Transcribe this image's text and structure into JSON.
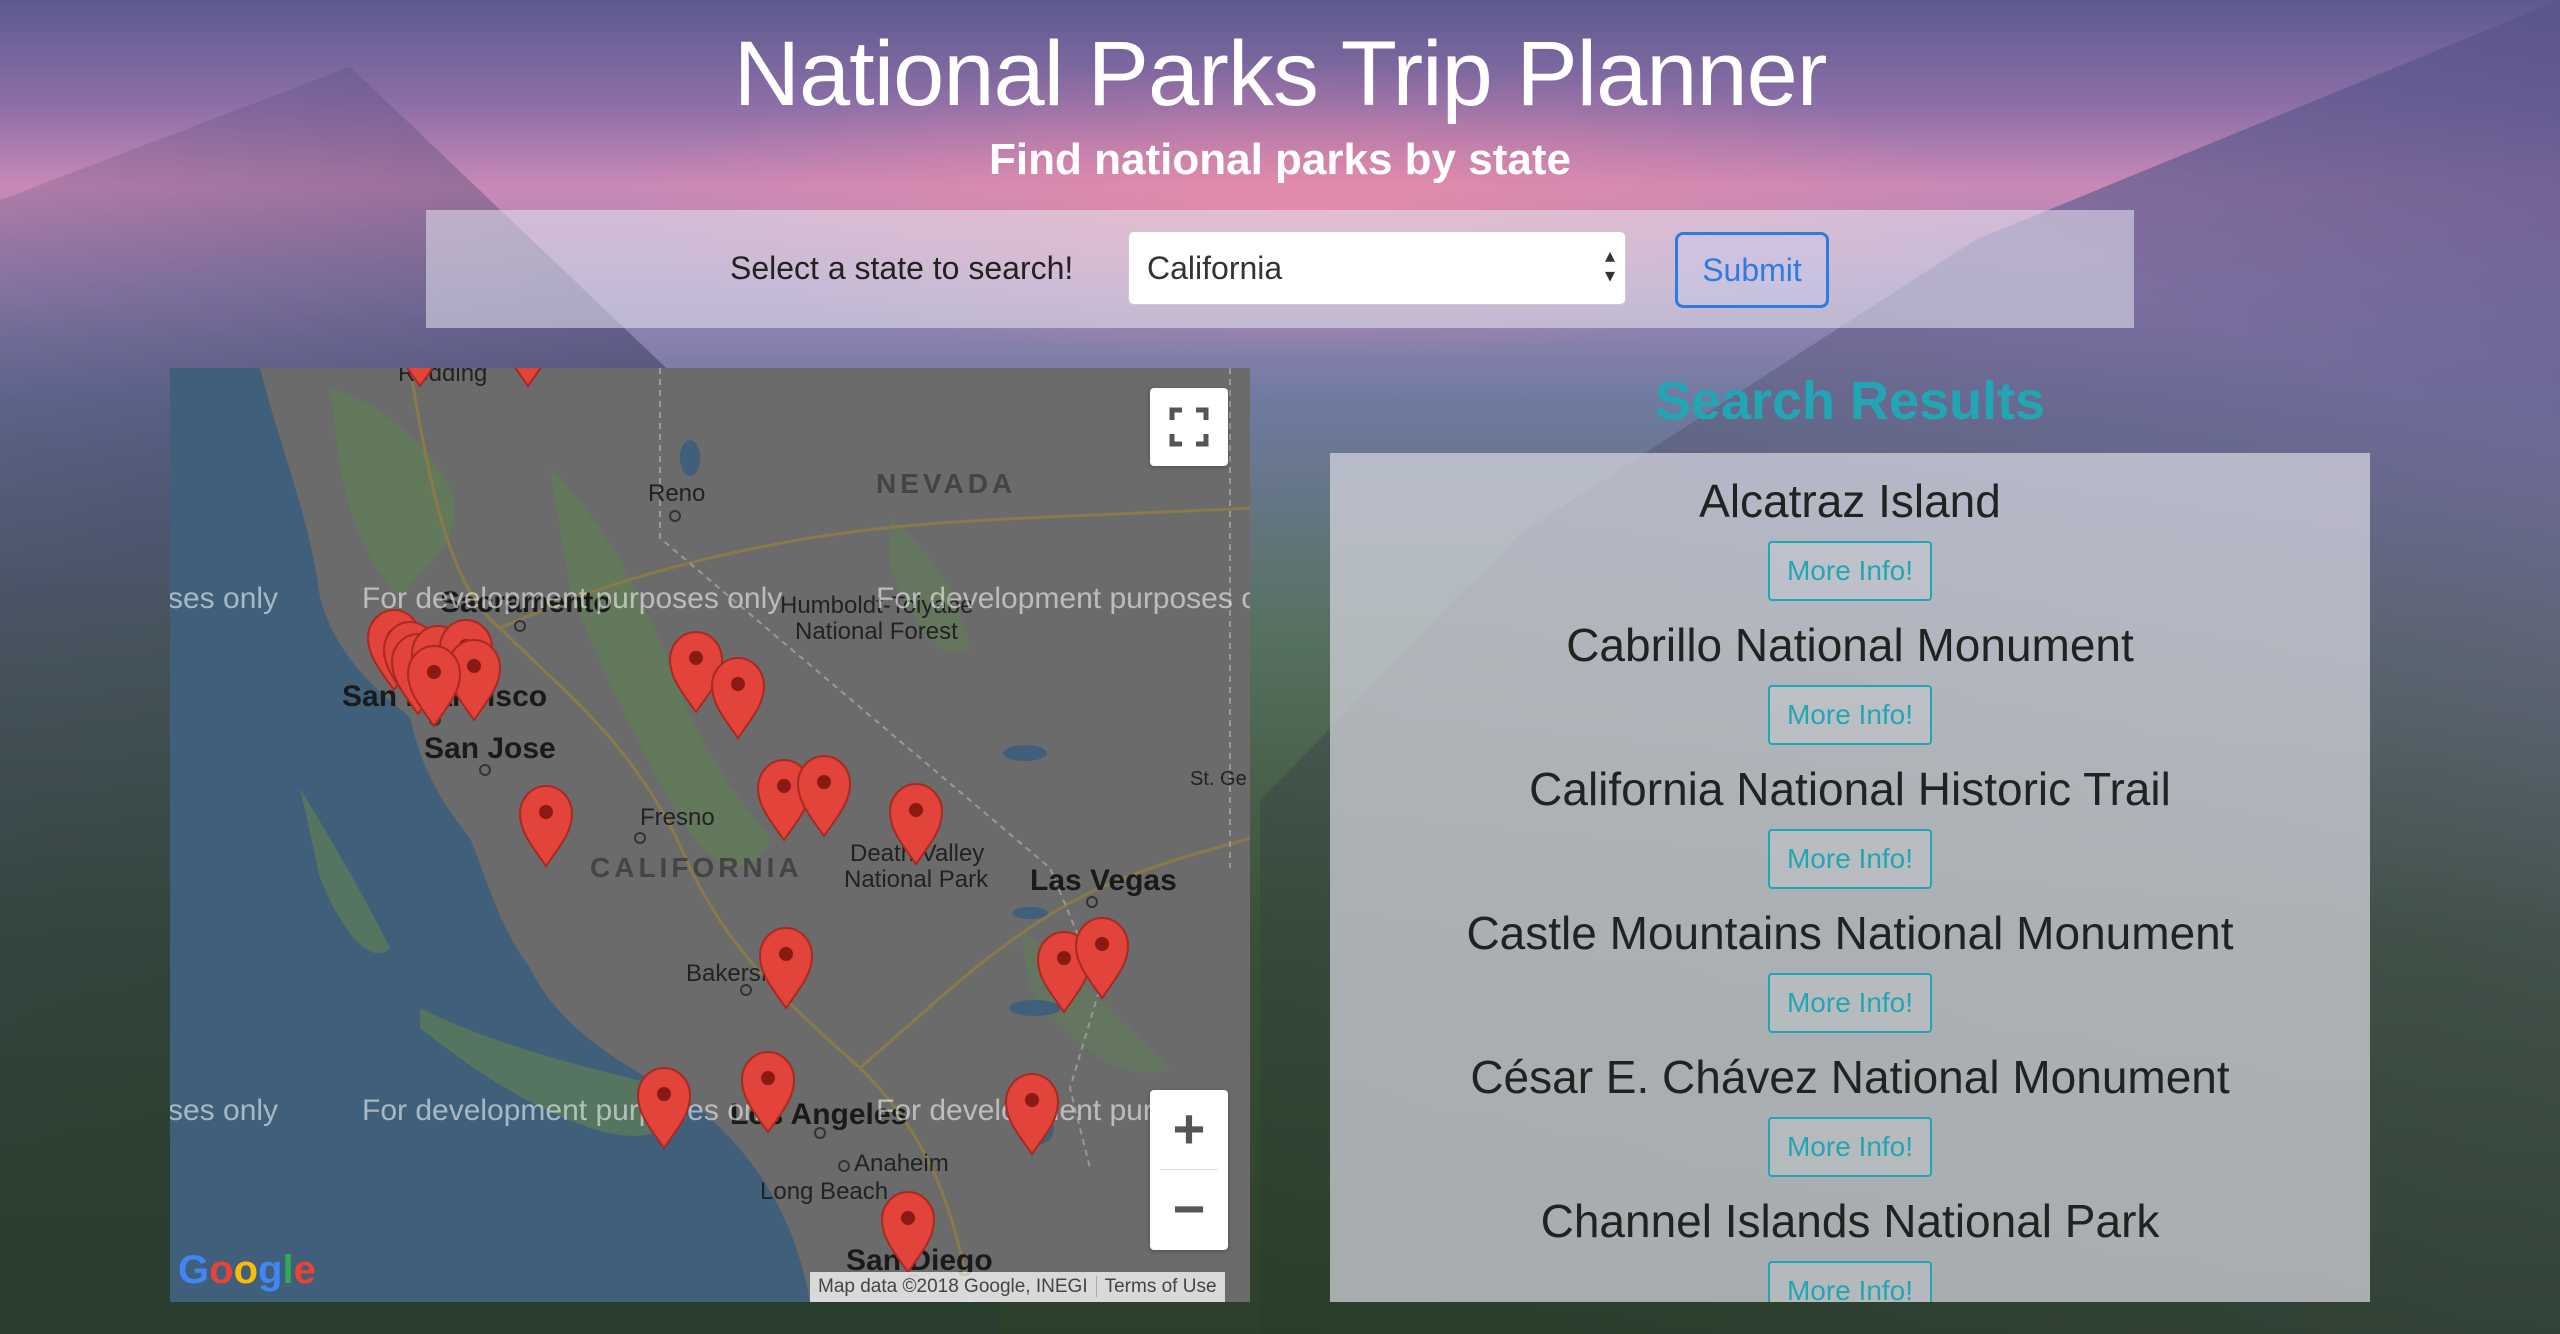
{
  "header": {
    "title": "National Parks Trip Planner",
    "subtitle": "Find national parks by state"
  },
  "search": {
    "label": "Select a state to search!",
    "selected_state": "California",
    "submit_label": "Submit"
  },
  "map": {
    "labels": {
      "redding": "Redding",
      "reno": "Reno",
      "nevada": "NEVADA",
      "sacramento": "Sacramento",
      "humboldt": "Humboldt-Toiyabe",
      "national_forest": "National Forest",
      "san_francisco": "San Francisco",
      "san_jose": "San Jose",
      "fresno": "Fresno",
      "california": "CALIFORNIA",
      "death_valley": "Death Valley",
      "national_park": "National Park",
      "las_vegas": "Las Vegas",
      "st_george": "St. Ge",
      "bakersfield": "Bakersfi",
      "los_angeles": "Los Angeles",
      "anaheim": "Anaheim",
      "long_beach": "Long Beach",
      "san_diego": "San Diego"
    },
    "watermark": "For development purposes only",
    "watermark_edge": "ses only",
    "watermark_cut": "For development purposes o",
    "watermark_cut2": "For development pur",
    "zoom_in": "+",
    "zoom_out": "−",
    "logo": "Google",
    "attribution": "Map data ©2018 Google, INEGI",
    "terms": "Terms of Use"
  },
  "results": {
    "title": "Search Results",
    "more_info_label": "More Info!",
    "items": [
      {
        "name": "Alcatraz Island"
      },
      {
        "name": "Cabrillo National Monument"
      },
      {
        "name": "California National Historic Trail"
      },
      {
        "name": "Castle Mountains National Monument"
      },
      {
        "name": "César E. Chávez National Monument"
      },
      {
        "name": "Channel Islands National Park"
      }
    ]
  },
  "colors": {
    "accent_teal": "#22a6b3",
    "submit_blue": "#2f7ce0",
    "pin_red": "#e2433a"
  }
}
